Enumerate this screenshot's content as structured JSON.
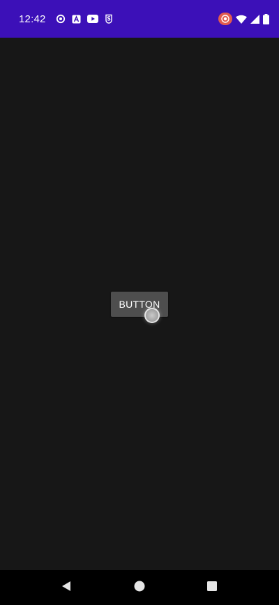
{
  "status_bar": {
    "time": "12:42",
    "background_color": "#3c10b8",
    "left_icons": [
      "settings-circle-icon",
      "text-a-icon",
      "youtube-icon",
      "s-badge-icon"
    ],
    "right_icons": [
      "cast-recording-icon",
      "wifi-icon",
      "signal-icon",
      "battery-icon"
    ]
  },
  "main": {
    "button_label": "BUTTON",
    "background_color": "#171717"
  },
  "nav_bar": {
    "icons": [
      "back-icon",
      "home-icon",
      "recents-icon"
    ]
  }
}
